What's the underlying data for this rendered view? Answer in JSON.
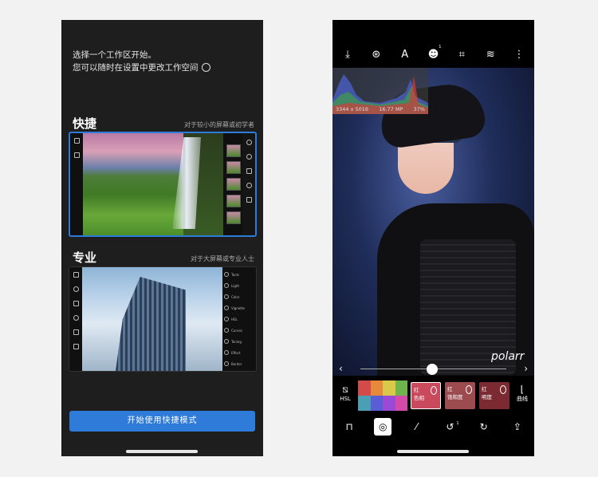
{
  "left_phone": {
    "intro_line1": "选择一个工作区开始。",
    "intro_line2": "您可以随时在设置中更改工作空间",
    "quick": {
      "title": "快捷",
      "desc": "对于较小的屏幕或初学者"
    },
    "pro": {
      "title": "专业",
      "desc": "对于大屏幕或专业人士",
      "menu": [
        "Tools",
        "Light",
        "Color",
        "Vignette",
        "HSL",
        "Curves",
        "Toning",
        "Effect",
        "Border"
      ]
    },
    "cta_label": "开始使用快捷模式"
  },
  "right_phone": {
    "histogram": {
      "dimensions": "3344 x 5016",
      "megapixels": "16.77 MP",
      "zoom": "37%"
    },
    "watermark": "polarr",
    "hsl_tab": "HSL",
    "curve_tab": "曲线",
    "params": [
      {
        "line1": "红",
        "line2": "色相",
        "color": "#c94a5c"
      },
      {
        "line1": "红",
        "line2": "饱和度",
        "color": "#9c4b4f"
      },
      {
        "line1": "红",
        "line2": "明度",
        "color": "#7a2a30"
      }
    ],
    "swatch_colors": [
      "#d34a4a",
      "#e58a3a",
      "#d9c84a",
      "#6fb44a",
      "#4a9fb4",
      "#5a5ed4",
      "#9a4ad4",
      "#d44aa8"
    ],
    "accent": "#2f7bd9"
  }
}
